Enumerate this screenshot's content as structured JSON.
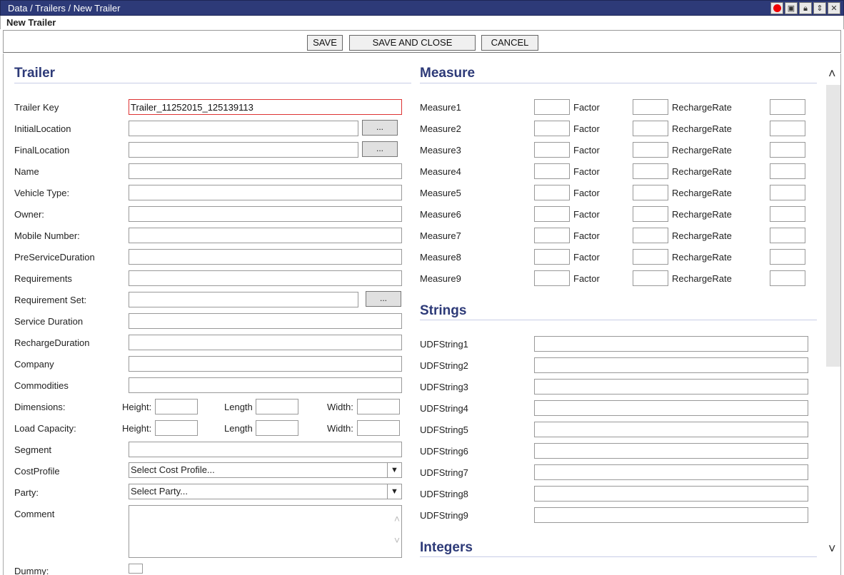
{
  "window": {
    "breadcrumb": "Data / Trailers / New Trailer",
    "subtitle": "New Trailer"
  },
  "toolbar": {
    "save": "SAVE",
    "save_close": "SAVE AND CLOSE",
    "cancel": "CANCEL"
  },
  "trailer": {
    "title": "Trailer",
    "trailer_key_label": "Trailer Key",
    "trailer_key_value": "Trailer_11252015_125139113",
    "initial_location": "InitialLocation",
    "final_location": "FinalLocation",
    "name": "Name",
    "vehicle_type": "Vehicle Type:",
    "owner": "Owner:",
    "mobile_number": "Mobile Number:",
    "pre_service_duration": "PreServiceDuration",
    "requirements": "Requirements",
    "requirement_set": "Requirement Set:",
    "service_duration": "Service Duration",
    "recharge_duration": "RechargeDuration",
    "company": "Company",
    "commodities": "Commodities",
    "dimensions": "Dimensions:",
    "load_capacity": "Load Capacity:",
    "height": "Height:",
    "length": "Length",
    "width": "Width:",
    "segment": "Segment",
    "cost_profile": "CostProfile",
    "cost_profile_placeholder": "Select Cost Profile...",
    "party": "Party:",
    "party_placeholder": "Select Party...",
    "comment": "Comment",
    "dummy": "Dummy:",
    "dots": "..."
  },
  "measure": {
    "title": "Measure",
    "factor": "Factor",
    "recharge_rate": "RechargeRate",
    "rows": [
      "Measure1",
      "Measure2",
      "Measure3",
      "Measure4",
      "Measure5",
      "Measure6",
      "Measure7",
      "Measure8",
      "Measure9"
    ]
  },
  "strings": {
    "title": "Strings",
    "rows": [
      "UDFString1",
      "UDFString2",
      "UDFString3",
      "UDFString4",
      "UDFString5",
      "UDFString6",
      "UDFString7",
      "UDFString8",
      "UDFString9"
    ]
  },
  "integers": {
    "title": "Integers"
  },
  "icons": [
    "record-icon",
    "save-icon",
    "lock-icon",
    "resize-icon",
    "close-icon",
    "scroll-up-icon",
    "scroll-down-icon",
    "dropdown-arrow-icon"
  ]
}
